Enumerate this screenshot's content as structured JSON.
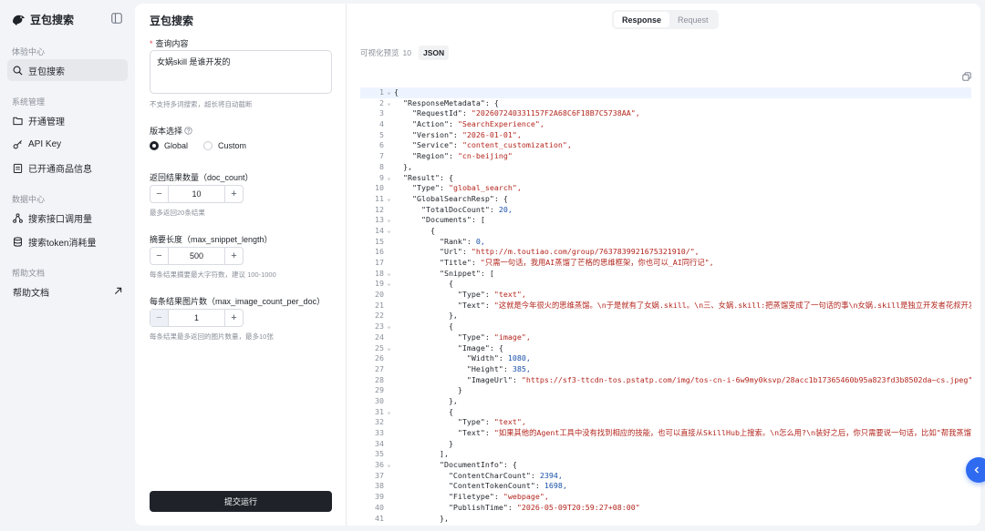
{
  "sidebar": {
    "brand": "豆包搜索",
    "sections": [
      {
        "title": "体验中心",
        "items": [
          {
            "label": "豆包搜索",
            "icon": "search-icon",
            "active": true
          }
        ]
      },
      {
        "title": "系统管理",
        "items": [
          {
            "label": "开通管理",
            "icon": "folder-icon"
          },
          {
            "label": "API Key",
            "icon": "key-icon"
          },
          {
            "label": "已开通商品信息",
            "icon": "clipboard-icon"
          }
        ]
      },
      {
        "title": "数据中心",
        "items": [
          {
            "label": "搜索接口调用量",
            "icon": "nodes-icon"
          },
          {
            "label": "搜索token消耗量",
            "icon": "database-icon"
          }
        ]
      },
      {
        "title": "帮助文档",
        "items": [
          {
            "label": "帮助文档",
            "icon": "external-link-icon"
          }
        ]
      }
    ]
  },
  "form": {
    "title": "豆包搜索",
    "query_label": "查询内容",
    "query_value": "女娲skill 是谁开发的",
    "query_hint": "不支持多词搜索，超长将自动截断",
    "version_label": "版本选择",
    "version_options": [
      "Global",
      "Custom"
    ],
    "version_selected": "Global",
    "doc_count_label": "返回结果数量（doc_count）",
    "doc_count_value": "10",
    "doc_count_hint": "最多返回20条结果",
    "snippet_label": "摘要长度（max_snippet_length）",
    "snippet_value": "500",
    "snippet_hint": "每条结果摘要最大字符数，建议 100-1000",
    "image_label": "每条结果图片数（max_image_count_per_doc）",
    "image_value": "1",
    "image_hint": "每条结果最多返回的图片数量，最多10张",
    "submit_label": "提交运行"
  },
  "result": {
    "tabs": [
      "Response",
      "Request"
    ],
    "active_tab": "Response",
    "view_tabs": {
      "visual": "可视化预览",
      "visual_count": "10",
      "json": "JSON"
    },
    "lines": [
      {
        "n": "1",
        "fold": true,
        "t": "{"
      },
      {
        "n": "2",
        "fold": true,
        "t": "  \"ResponseMetadata\": {"
      },
      {
        "n": "3",
        "t": "    \"RequestId\": \"202607240331157F2A68C6F18B7C5738AA\","
      },
      {
        "n": "4",
        "t": "    \"Action\": \"SearchExperience\","
      },
      {
        "n": "5",
        "t": "    \"Version\": \"2026-01-01\","
      },
      {
        "n": "6",
        "t": "    \"Service\": \"content_customization\","
      },
      {
        "n": "7",
        "t": "    \"Region\": \"cn-beijing\""
      },
      {
        "n": "8",
        "t": "  },"
      },
      {
        "n": "9",
        "fold": true,
        "t": "  \"Result\": {"
      },
      {
        "n": "10",
        "t": "    \"Type\": \"global_search\","
      },
      {
        "n": "11",
        "fold": true,
        "t": "    \"GlobalSearchResp\": {"
      },
      {
        "n": "12",
        "t": "      \"TotalDocCount\": 20,"
      },
      {
        "n": "13",
        "fold": true,
        "t": "      \"Documents\": ["
      },
      {
        "n": "14",
        "fold": true,
        "t": "        {"
      },
      {
        "n": "15",
        "t": "          \"Rank\": 0,"
      },
      {
        "n": "16",
        "t": "          \"Url\": \"http://m.toutiao.com/group/7637839921675321910/\","
      },
      {
        "n": "17",
        "t": "          \"Title\": \"只需一句话，我用AI蒸馏了芒格的思维框架，你也可以_AI同行记\","
      },
      {
        "n": "18",
        "fold": true,
        "t": "          \"Snippet\": ["
      },
      {
        "n": "19",
        "fold": true,
        "t": "            {"
      },
      {
        "n": "20",
        "t": "              \"Type\": \"text\","
      },
      {
        "n": "21",
        "t": "              \"Text\": \"这就是今年很火的思维蒸馏。\\n于是就有了女娲.skill。\\n三、女娲.skill:把蒸馏变成了一句话的事\\n女娲.skill是独立开发者花叔开发"
      },
      {
        "n": "22",
        "t": "            },"
      },
      {
        "n": "23",
        "fold": true,
        "t": "            {"
      },
      {
        "n": "24",
        "t": "              \"Type\": \"image\","
      },
      {
        "n": "25",
        "fold": true,
        "t": "              \"Image\": {"
      },
      {
        "n": "26",
        "t": "                \"Width\": 1080,"
      },
      {
        "n": "27",
        "t": "                \"Height\": 385,"
      },
      {
        "n": "28",
        "t": "                \"ImageUrl\": \"https://sf3-ttcdn-tos.pstatp.com/img/tos-cn-i-6w9my0ksvp/28acc1b17365460b95a823fd3b8502da~cs.jpeg\""
      },
      {
        "n": "29",
        "t": "              }"
      },
      {
        "n": "30",
        "t": "            },"
      },
      {
        "n": "31",
        "fold": true,
        "t": "            {"
      },
      {
        "n": "32",
        "t": "              \"Type\": \"text\","
      },
      {
        "n": "33",
        "t": "              \"Text\": \"如果其他的Agent工具中没有找到相应的技能，也可以直接从SkillHub上搜索。\\n怎么用?\\n装好之后，你只需要说一句话，比如\"帮我蒸馏多"
      },
      {
        "n": "34",
        "t": "            }"
      },
      {
        "n": "35",
        "t": "          ],"
      },
      {
        "n": "36",
        "fold": true,
        "t": "          \"DocumentInfo\": {"
      },
      {
        "n": "37",
        "t": "            \"ContentCharCount\": 2394,"
      },
      {
        "n": "38",
        "t": "            \"ContentTokenCount\": 1698,"
      },
      {
        "n": "39",
        "t": "            \"Filetype\": \"webpage\","
      },
      {
        "n": "40",
        "t": "            \"PublishTime\": \"2026-05-09T20:59:27+08:00\""
      },
      {
        "n": "41",
        "t": "          },"
      }
    ]
  }
}
